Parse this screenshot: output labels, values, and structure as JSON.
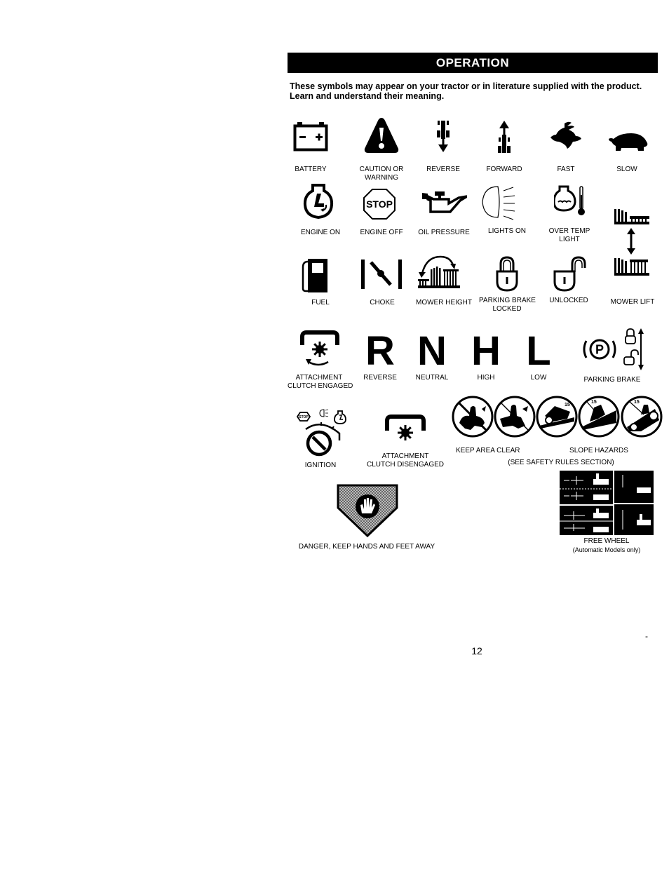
{
  "header": {
    "title": "OPERATION"
  },
  "intro": {
    "line1": "These symbols may appear on your tractor or in literature supplied with the product.",
    "line2": "Learn and understand their meaning."
  },
  "row1": [
    {
      "icon": "battery-icon",
      "label": "BATTERY"
    },
    {
      "icon": "caution-warning-icon",
      "label": "CAUTION OR",
      "label2": "WARNING"
    },
    {
      "icon": "reverse-icon",
      "label": "REVERSE"
    },
    {
      "icon": "forward-icon",
      "label": "FORWARD"
    },
    {
      "icon": "rabbit-fast-icon",
      "label": "FAST"
    },
    {
      "icon": "turtle-slow-icon",
      "label": "SLOW"
    }
  ],
  "row2": [
    {
      "icon": "engine-on-icon",
      "label": "ENGINE ON"
    },
    {
      "icon": "stop-sign-icon",
      "label": "ENGINE OFF",
      "sign_text": "STOP"
    },
    {
      "icon": "oil-can-icon",
      "label": "OIL PRESSURE"
    },
    {
      "icon": "headlight-icon",
      "label": "LIGHTS ON"
    },
    {
      "icon": "over-temp-icon",
      "label": "OVER TEMP",
      "label2": "LIGHT"
    }
  ],
  "row3": [
    {
      "icon": "fuel-pump-icon",
      "label": "FUEL"
    },
    {
      "icon": "choke-icon",
      "label": "CHOKE"
    },
    {
      "icon": "mower-height-icon",
      "label": "MOWER HEIGHT"
    },
    {
      "icon": "padlock-locked-icon",
      "label": "PARKING BRAKE",
      "label2": "LOCKED"
    },
    {
      "icon": "padlock-unlocked-icon",
      "label": "UNLOCKED"
    },
    {
      "icon": "mower-lift-icon",
      "label": "MOWER LIFT"
    }
  ],
  "row4": [
    {
      "icon": "attachment-clutch-engaged-icon",
      "label": "ATTACHMENT",
      "label2": "CLUTCH ENGAGED"
    },
    {
      "icon": "gear-r-icon",
      "glyph": "R",
      "label": "REVERSE"
    },
    {
      "icon": "gear-n-icon",
      "glyph": "N",
      "label": "NEUTRAL"
    },
    {
      "icon": "gear-h-icon",
      "glyph": "H",
      "label": "HIGH"
    },
    {
      "icon": "gear-l-icon",
      "glyph": "L",
      "label": "LOW"
    },
    {
      "icon": "parking-brake-icon",
      "glyph": "P",
      "label": "PARKING BRAKE"
    }
  ],
  "row5": {
    "ignition": {
      "label": "IGNITION",
      "stop_text": "STOP"
    },
    "clutch_disengaged": {
      "label": "ATTACHMENT",
      "label2": "CLUTCH DISENGAGED"
    },
    "keep_clear": {
      "label": "KEEP AREA CLEAR"
    },
    "slope": {
      "label": "SLOPE HAZARDS",
      "slope_angle": "15"
    },
    "see_rules": "(SEE SAFETY RULES SECTION)"
  },
  "row6": {
    "danger": {
      "label": "DANGER, KEEP HANDS AND FEET AWAY"
    },
    "free_wheel": {
      "label": "FREE WHEEL",
      "label2": "(Automatic Models only)"
    }
  },
  "footer": {
    "page_number": "12",
    "mark": "-"
  }
}
